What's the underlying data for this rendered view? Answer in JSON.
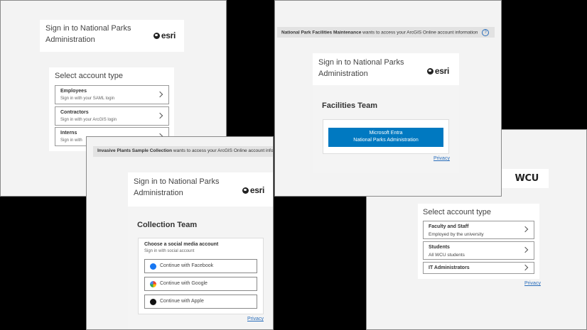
{
  "brand": {
    "esri": "esri",
    "wcu": "WCU"
  },
  "p1": {
    "title": "Sign in to National Parks Administration",
    "heading": "Select account type",
    "options": [
      {
        "title": "Employees",
        "desc": "Sign in with your SAML login"
      },
      {
        "title": "Contractors",
        "desc": "Sign in with your ArcGIS login"
      },
      {
        "title": "Interns",
        "desc": "Sign in with"
      }
    ]
  },
  "p2": {
    "banner_app": "National Park Facilities Maintenance",
    "banner_rest": " wants to access your ArcGIS Online account information",
    "title": "Sign in to National Parks Administration",
    "team": "Facilities Team",
    "button_line1": "Microsoft Entra",
    "button_line2": "National Parks Administration",
    "privacy": "Privacy",
    "button_color": "#0079c1"
  },
  "p3": {
    "banner_app": "Invasive Plants Sample Collection",
    "banner_rest": " wants to access your ArcGIS Online account info",
    "title": "Sign in to National Parks Administration",
    "team": "Collection Team",
    "social_heading": "Choose a social media account",
    "social_sub": "Sign in with social account",
    "buttons": [
      {
        "label": "Continue with Facebook",
        "icon": "facebook-icon"
      },
      {
        "label": "Continue with Google",
        "icon": "google-icon"
      },
      {
        "label": "Continue with Apple",
        "icon": "apple-icon"
      }
    ],
    "privacy": "Privacy"
  },
  "p4": {
    "heading": "Select account type",
    "options": [
      {
        "title": "Faculty and Staff",
        "desc": "Employed by the university"
      },
      {
        "title": "Students",
        "desc": "All WCU students"
      },
      {
        "title": "IT Administrators",
        "desc": ""
      }
    ],
    "privacy": "Privacy"
  }
}
